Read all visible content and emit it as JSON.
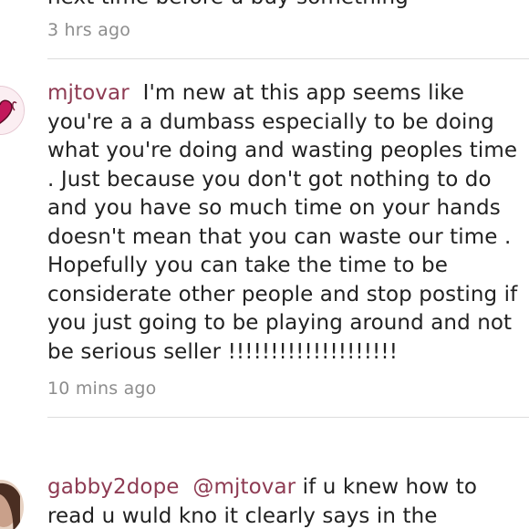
{
  "comments": [
    {
      "text": "next time before u buy something",
      "timestamp": "3 hrs ago"
    },
    {
      "username": "mjtovar",
      "text": "I'm new at this app seems like you're a a dumbass especially to be doing what you're doing and wasting peoples time . Just because you don't got nothing to do and you have so much time on your hands doesn't mean that you can waste our time . Hopefully you can take the time to be considerate other people and stop posting if you just going to be playing around and not be serious seller !!!!!!!!!!!!!!!!!!!!",
      "timestamp": "10 mins ago",
      "avatar_icon": "heart-emblem-avatar"
    },
    {
      "username": "gabby2dope",
      "mention": "@mjtovar",
      "text": "if u knew how to read u wuld kno it clearly says in the",
      "avatar_icon": "user-photo-avatar"
    }
  ],
  "colors": {
    "username": "#8e3b53",
    "timestamp": "#8d8d8d",
    "divider": "#dcdcdc",
    "text": "#222222"
  }
}
